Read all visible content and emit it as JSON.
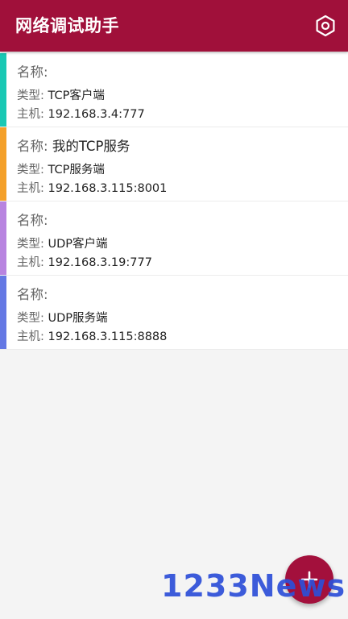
{
  "appbar": {
    "title": "网络调试助手",
    "background": "#a0103a",
    "settings_icon": "hexagon-settings-icon"
  },
  "labels": {
    "name": "名称:",
    "type": "类型:",
    "host": "主机:"
  },
  "connections": [
    {
      "color": "#19c8b4",
      "name": "",
      "type": "TCP客户端",
      "host": "192.168.3.4:777"
    },
    {
      "color": "#f4a02a",
      "name": "我的TCP服务",
      "type": "TCP服务端",
      "host": "192.168.3.115:8001"
    },
    {
      "color": "#b884e0",
      "name": "",
      "type": "UDP客户端",
      "host": "192.168.3.19:777"
    },
    {
      "color": "#6478e4",
      "name": "",
      "type": "UDP服务端",
      "host": "192.168.3.115:8888"
    }
  ],
  "fab": {
    "icon": "plus-icon",
    "color": "#a3103c"
  },
  "watermark": "1233News"
}
